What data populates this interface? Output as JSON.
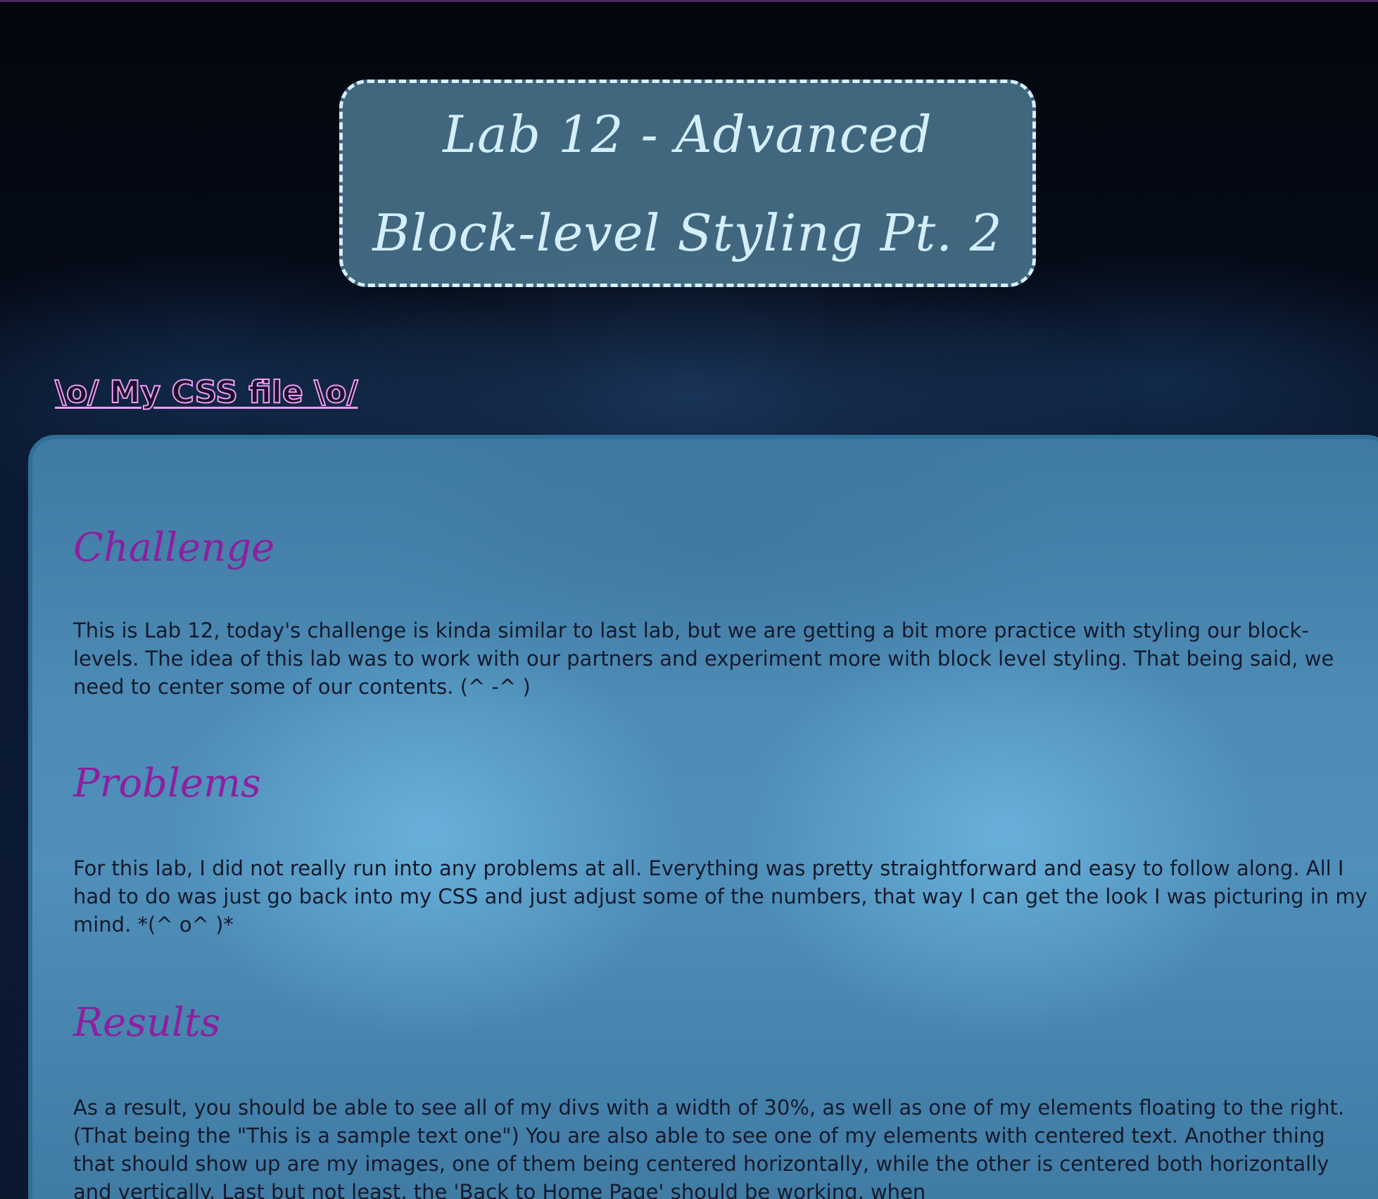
{
  "header": {
    "title": "Lab 12 - Advanced Block-level Styling Pt. 2"
  },
  "css_link": {
    "label": "\\o/ My CSS file \\o/"
  },
  "sections": [
    {
      "heading": "Challenge",
      "text": "This is Lab 12, today's challenge is kinda similar to last lab, but we are getting a bit more practice with styling our block-levels. The idea of this lab was to work with our partners and experiment more with block level styling. That being said, we need to center some of our contents. (^ -^ )"
    },
    {
      "heading": "Problems",
      "text": "For this lab, I did not really run into any problems at all. Everything was pretty straightforward and easy to follow along. All I had to do was just go back into my CSS and just adjust some of the numbers, that way I can get the look I was picturing in my mind. *(^ o^ )*"
    },
    {
      "heading": "Results",
      "text": "As a result, you should be able to see all of my divs with a width of 30%, as well as one of my elements floating to the right. (That being the \"This is a sample text one\") You are also able to see one of my elements with centered text. Another thing that should show up are my images, one of them being centered horizontally, while the other is centered both horizontally and vertically. Last but not least, the 'Back to Home Page' should be working, when"
    }
  ],
  "colors": {
    "title_border": "#d7eefc",
    "title_text": "#d3eefc",
    "heading": "#8e1f9e",
    "link_outline": "#ee9cf5",
    "panel_border": "#2f6f98"
  }
}
